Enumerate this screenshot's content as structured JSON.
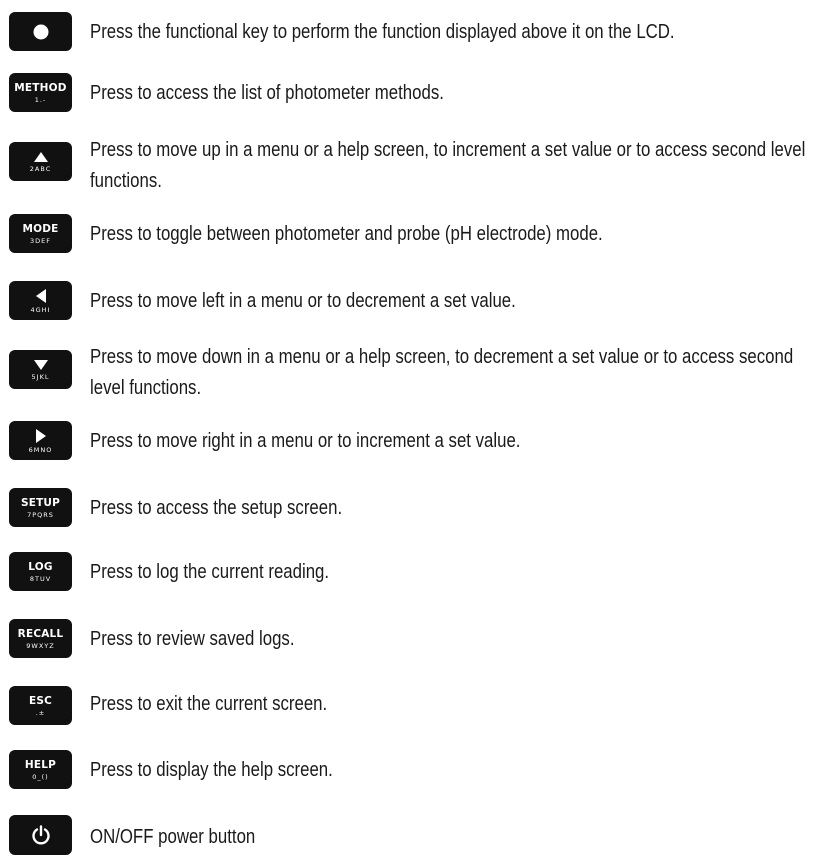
{
  "keys": [
    {
      "label": "",
      "sub": "",
      "icon": "circle-icon",
      "description": "Press the functional key to perform the function displayed above it on the LCD."
    },
    {
      "label": "METHOD",
      "sub": "1.-",
      "icon": "",
      "description": "Press to access the list of photometer methods."
    },
    {
      "label": "",
      "sub": "2ABC",
      "icon": "up-arrow-icon",
      "description": "Press to move up in a menu or a help screen, to increment a set value or to access second level functions."
    },
    {
      "label": "MODE",
      "sub": "3DEF",
      "icon": "",
      "description": "Press to toggle between photometer and probe (pH electrode) mode."
    },
    {
      "label": "",
      "sub": "4GHI",
      "icon": "left-arrow-icon",
      "description": "Press to move left in a menu or to decrement a set value."
    },
    {
      "label": "",
      "sub": "5JKL",
      "icon": "down-arrow-icon",
      "description": "Press to move down in a menu or a help screen, to decrement a set value or to access second level functions."
    },
    {
      "label": "",
      "sub": "6MNO",
      "icon": "right-arrow-icon",
      "description": "Press to move right in a menu or to increment a set value."
    },
    {
      "label": "SETUP",
      "sub": "7PQRS",
      "icon": "",
      "description": "Press to access the setup screen."
    },
    {
      "label": "LOG",
      "sub": "8TUV",
      "icon": "",
      "description": "Press to log the current reading."
    },
    {
      "label": "RECALL",
      "sub": "9WXYZ",
      "icon": "",
      "description": "Press to review saved logs."
    },
    {
      "label": "ESC",
      "sub": ".±",
      "icon": "",
      "description": "Press to exit the current screen."
    },
    {
      "label": "HELP",
      "sub": "0_()",
      "icon": "",
      "description": "Press to display the help screen."
    },
    {
      "label": "",
      "sub": "",
      "icon": "power-icon",
      "description": "ON/OFF power button"
    }
  ],
  "colors": {
    "key_background": "#111111",
    "key_text": "#ffffff",
    "text": "#1a1a1a"
  }
}
